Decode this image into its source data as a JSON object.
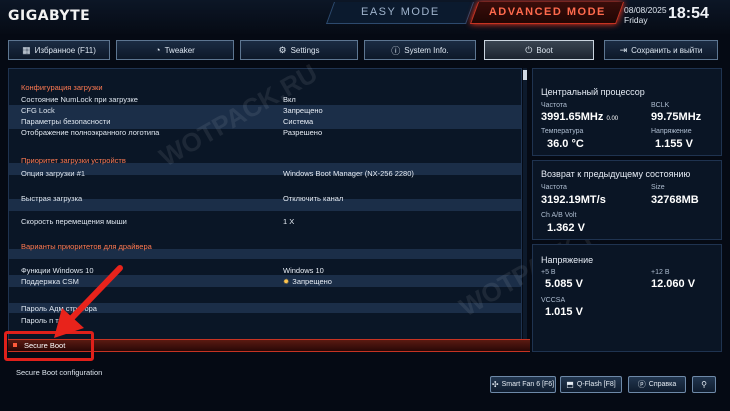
{
  "header": {
    "logo": "GIGABYTE",
    "easy_mode": "EASY MODE",
    "advanced_mode": "ADVANCED MODE",
    "date": "08/08/2025",
    "weekday": "Friday",
    "time": "18:54"
  },
  "tabs": [
    {
      "label": "Избранное (F11)",
      "icon": "star-icon"
    },
    {
      "label": "Tweaker",
      "icon": "gauge-icon"
    },
    {
      "label": "Settings",
      "icon": "gear-icon"
    },
    {
      "label": "System Info.",
      "icon": "info-icon"
    },
    {
      "label": "Boot",
      "icon": "power-icon"
    },
    {
      "label": "Сохранить и выйти",
      "icon": "exit-icon"
    }
  ],
  "settings": {
    "sect1": "Конфигурация загрузки",
    "numlock_label": "Состояние NumLock при загрузке",
    "numlock_value": "Вкл",
    "cfg_lock_label": "CFG Lock",
    "cfg_lock_value": "Запрещено",
    "security_label": "Параметры безопасности",
    "security_value": "Система",
    "logo_label": "Отображение полноэкранного логотипа",
    "logo_value": "Разрешено",
    "sect2": "Приоритет загрузки устройств",
    "boot1_label": "Опция загрузки #1",
    "boot1_value": "Windows Boot Manager (NX-256 2280)",
    "fastboot_label": "Быстрая загрузка",
    "fastboot_value": "Отключить канал",
    "mouse_label": "Скорость перемещения мыши",
    "mouse_value": "1 X",
    "sect3": "Варианты приоритетов для драйвера",
    "win10_label": "Функции Windows 10",
    "win10_value": "Windows 10",
    "csm_label": "Поддержка CSM",
    "csm_value": "Запрещено",
    "admin_pw_label": "Пароль Адм   стратора",
    "user_pw_label": "Пароль п     теля",
    "secure_boot": "Secure Boot",
    "description": "Secure Boot configuration"
  },
  "cpu": {
    "title": "Центральный процессор",
    "freq_label": "Частота",
    "freq_value": "3991.65MHz",
    "freq_sub": "0.00",
    "bclk_label": "BCLK",
    "bclk_value": "99.75MHz",
    "temp_label": "Температура",
    "temp_value": "36.0 °C",
    "volt_label": "Напряжение",
    "volt_value": "1.155 V"
  },
  "memory": {
    "title": "Возврат к предыдущему состоянию",
    "freq_label": "Частота",
    "freq_value": "3192.19MT/s",
    "size_label": "Size",
    "size_value": "32768MB",
    "volt_label": "Ch A/B Volt",
    "volt_value": "1.362 V"
  },
  "voltage": {
    "title": "Напряжение",
    "v5_label": "+5 В",
    "v5_value": "5.085 V",
    "v12_label": "+12 В",
    "v12_value": "12.060 V",
    "vccsa_label": "VCCSA",
    "vccsa_value": "1.015 V"
  },
  "bottom": {
    "smartfan": "Smart Fan 6 [F6]",
    "qflash": "Q-Flash [F8]",
    "help": "Справка"
  },
  "watermark": "WOTPACK.RU"
}
